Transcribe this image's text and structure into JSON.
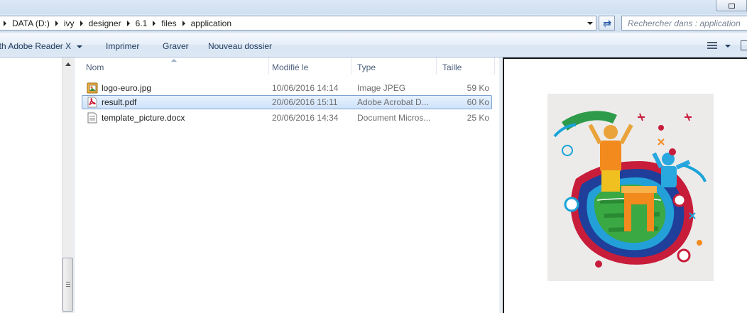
{
  "breadcrumb": [
    "DATA (D:)",
    "ivy",
    "designer",
    "6.1",
    "files",
    "application"
  ],
  "search": {
    "placeholder": "Rechercher dans : application"
  },
  "toolbar": {
    "open_with": "ith Adobe Reader X",
    "print": "Imprimer",
    "burn": "Graver",
    "new_folder": "Nouveau dossier"
  },
  "columns": {
    "name": "Nom",
    "modified": "Modifié le",
    "type": "Type",
    "size": "Taille"
  },
  "files": [
    {
      "name": "logo-euro.jpg",
      "modified": "10/06/2016 14:14",
      "type": "Image JPEG",
      "size": "59 Ko",
      "icon": "jpeg-file-icon",
      "selected": false
    },
    {
      "name": "result.pdf",
      "modified": "20/06/2016 15:11",
      "type": "Adobe Acrobat D...",
      "size": "60 Ko",
      "icon": "pdf-file-icon",
      "selected": true
    },
    {
      "name": "template_picture.docx",
      "modified": "20/06/2016 14:34",
      "type": "Document Micros...",
      "size": "25 Ko",
      "icon": "docx-file-icon",
      "selected": false
    }
  ],
  "colors": {
    "selection": "#cfe3fb",
    "selection_border": "#7da2ce",
    "toolbar_text": "#1e395b"
  }
}
